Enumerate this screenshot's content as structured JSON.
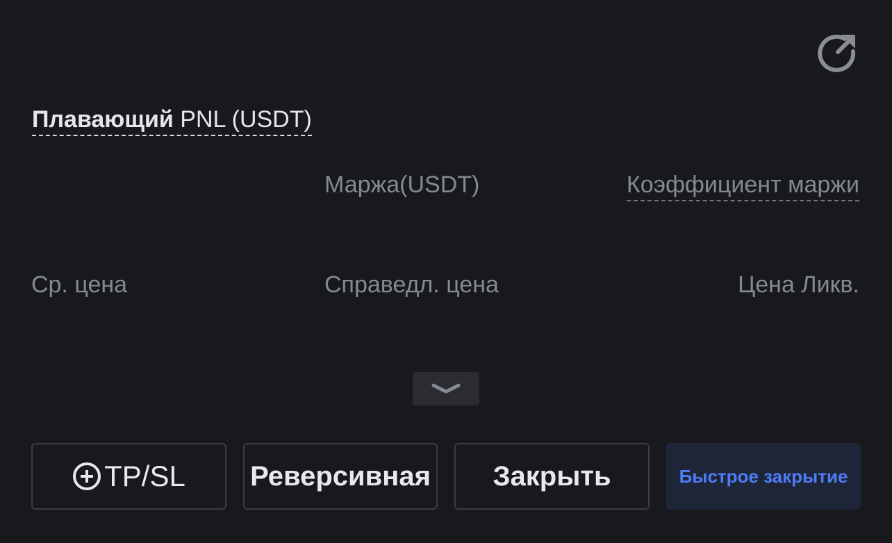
{
  "header": {
    "share_icon": "share-icon"
  },
  "pnl": {
    "title_bold": "Плавающий",
    "title_rest": " PNL (USDT)"
  },
  "labels": {
    "margin": "Маржа(USDT)",
    "margin_ratio": "Коэффициент маржи",
    "avg_price": "Ср. цена",
    "mark_price": "Справедл. цена",
    "liq_price": "Цена Ликв."
  },
  "expand": {
    "icon": "chevron-down-icon"
  },
  "actions": {
    "tpsl_label": "TP/SL",
    "reverse_label": "Реверсивная",
    "close_label": "Закрыть",
    "quick_close_label": "Быстрое закрытие"
  },
  "colors": {
    "background": "#18191c",
    "text_primary": "#e6e7ea",
    "text_secondary": "#858992",
    "accent": "#4d7cf5",
    "quick_close_bg": "#1f2538"
  }
}
